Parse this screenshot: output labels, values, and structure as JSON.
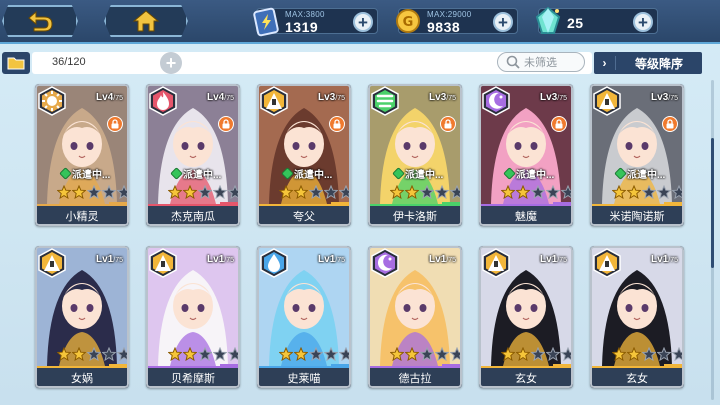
{
  "resources": [
    {
      "id": "stamina",
      "icon": "stamina-card-icon",
      "max_label": "MAX:3800",
      "value": "1319"
    },
    {
      "id": "gold",
      "icon": "gold-coin-icon",
      "max_label": "MAX:29000",
      "value": "9838"
    },
    {
      "id": "gems",
      "icon": "crystal-gem-icon",
      "max_label": "",
      "value": "25"
    }
  ],
  "filter": {
    "count": "36/120",
    "search_placeholder": "未筛选",
    "sort_label": "等级降序",
    "sort_arrow": "›"
  },
  "colors": {
    "sun": "#e6a94a",
    "fire": "#e5566b",
    "thunder": "#f2b63a",
    "wind": "#4bd16a",
    "dark": "#a76de2",
    "water": "#4aa6e9"
  },
  "cards": [
    {
      "name": "小精灵",
      "level": "Lv4",
      "max": "/75",
      "element": "sun",
      "locked": true,
      "dispatch": "派遣中...",
      "stars": 2,
      "theme": "#e6a94a"
    },
    {
      "name": "杰克南瓜",
      "level": "Lv4",
      "max": "/75",
      "element": "fire",
      "locked": true,
      "dispatch": "派遣中...",
      "stars": 2,
      "theme": "#e5566b"
    },
    {
      "name": "夸父",
      "level": "Lv3",
      "max": "/75",
      "element": "thunder",
      "locked": true,
      "dispatch": "派遣中...",
      "stars": 2,
      "theme": "#f2b63a"
    },
    {
      "name": "伊卡洛斯",
      "level": "Lv3",
      "max": "/75",
      "element": "wind",
      "locked": true,
      "dispatch": "派遣中...",
      "stars": 2,
      "theme": "#4bd16a"
    },
    {
      "name": "魅魔",
      "level": "Lv3",
      "max": "/75",
      "element": "dark",
      "locked": true,
      "dispatch": "派遣中...",
      "stars": 2,
      "theme": "#a76de2"
    },
    {
      "name": "米诺陶诺斯",
      "level": "Lv3",
      "max": "/75",
      "element": "thunder",
      "locked": true,
      "dispatch": "派遣中...",
      "stars": 2,
      "theme": "#f2b63a"
    },
    {
      "name": "女娲",
      "level": "Lv1",
      "max": "/75",
      "element": "thunder",
      "locked": false,
      "dispatch": "",
      "stars": 2,
      "theme": "#f2b63a"
    },
    {
      "name": "贝希摩斯",
      "level": "Lv1",
      "max": "/75",
      "element": "thunder",
      "locked": false,
      "dispatch": "",
      "stars": 2,
      "theme": "#a76de2"
    },
    {
      "name": "史莱喵",
      "level": "Lv1",
      "max": "/75",
      "element": "water",
      "locked": false,
      "dispatch": "",
      "stars": 2,
      "theme": "#4aa6e9"
    },
    {
      "name": "德古拉",
      "level": "Lv1",
      "max": "/75",
      "element": "dark",
      "locked": false,
      "dispatch": "",
      "stars": 2,
      "theme": "#a76de2"
    },
    {
      "name": "玄女",
      "level": "Lv1",
      "max": "/75",
      "element": "thunder",
      "locked": false,
      "dispatch": "",
      "stars": 2,
      "theme": "#f2b63a"
    },
    {
      "name": "玄女",
      "level": "Lv1",
      "max": "/75",
      "element": "thunder",
      "locked": false,
      "dispatch": "",
      "stars": 2,
      "theme": "#f2b63a"
    }
  ]
}
